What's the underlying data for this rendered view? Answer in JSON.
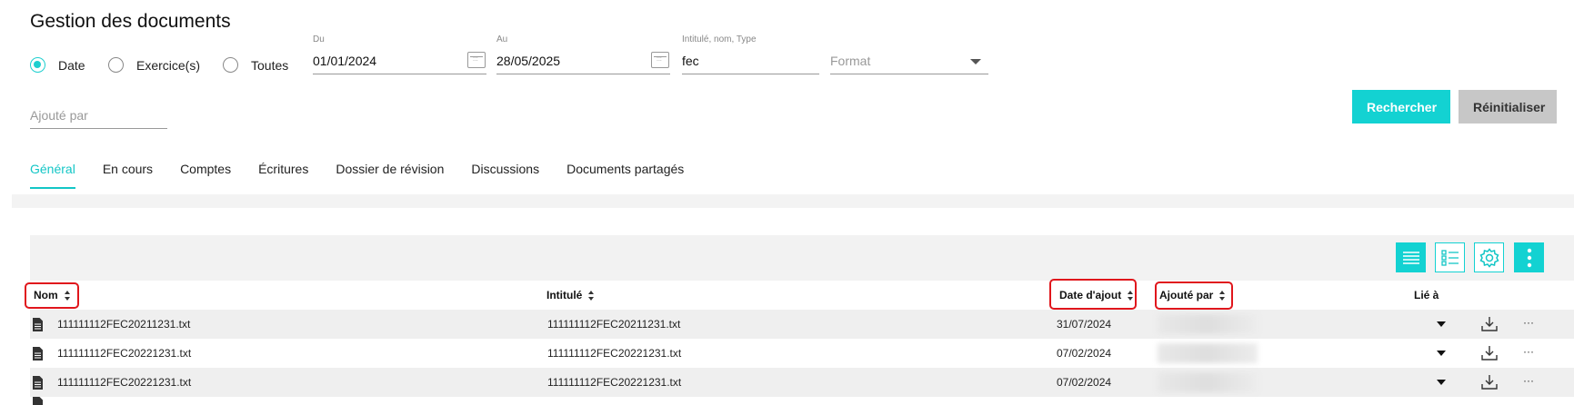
{
  "page": {
    "title": "Gestion des documents"
  },
  "filters": {
    "radios": [
      {
        "label": "Date",
        "selected": true
      },
      {
        "label": "Exercice(s)",
        "selected": false
      },
      {
        "label": "Toutes",
        "selected": false
      }
    ],
    "from": {
      "label": "Du",
      "value": "01/01/2024"
    },
    "to": {
      "label": "Au",
      "value": "28/05/2025"
    },
    "search": {
      "label": "Intitulé, nom, Type",
      "value": "fec"
    },
    "format": {
      "placeholder": "Format"
    },
    "added_by": {
      "placeholder": "Ajouté par"
    }
  },
  "actions": {
    "search": "Rechercher",
    "reset": "Réinitialiser"
  },
  "tabs": [
    {
      "label": "Général",
      "active": true
    },
    {
      "label": "En cours"
    },
    {
      "label": "Comptes"
    },
    {
      "label": "Écritures"
    },
    {
      "label": "Dossier de révision"
    },
    {
      "label": "Discussions"
    },
    {
      "label": "Documents partagés"
    }
  ],
  "table": {
    "columns": {
      "nom": "Nom",
      "intitule": "Intitulé",
      "date": "Date d'ajout",
      "ajoute": "Ajouté par",
      "lie": "Lié à"
    },
    "rows": [
      {
        "nom": "111111112FEC20211231.txt",
        "intitule": "111111112FEC20211231.txt",
        "date": "31/07/2024"
      },
      {
        "nom": "111111112FEC20221231.txt",
        "intitule": "111111112FEC20221231.txt",
        "date": "07/02/2024"
      },
      {
        "nom": "111111112FEC20221231.txt",
        "intitule": "111111112FEC20221231.txt",
        "date": "07/02/2024"
      }
    ],
    "more_glyph": "···"
  },
  "colors": {
    "accent": "#13d2d2",
    "highlight": "#e0161c"
  }
}
